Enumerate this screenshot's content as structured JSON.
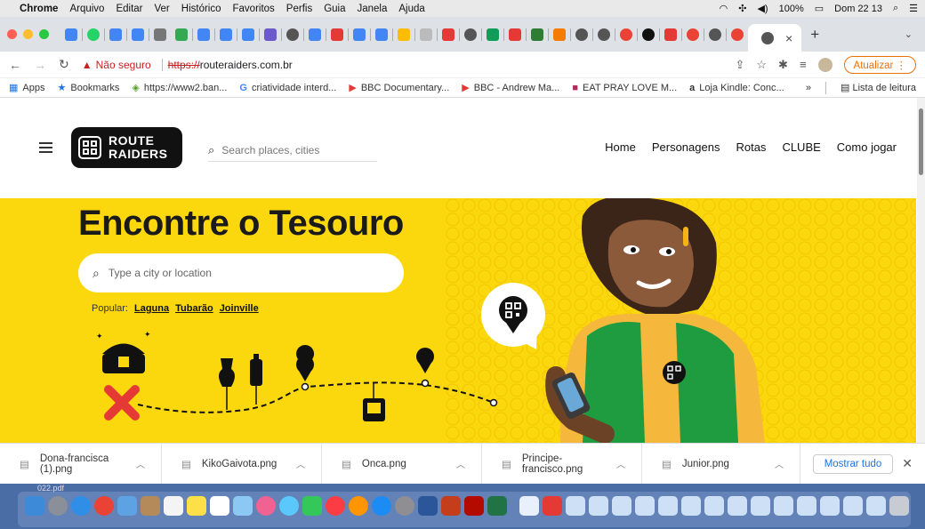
{
  "menubar": {
    "app": "Chrome",
    "items": [
      "Arquivo",
      "Editar",
      "Ver",
      "Histórico",
      "Favoritos",
      "Perfis",
      "Guia",
      "Janela",
      "Ajuda"
    ],
    "battery": "100%",
    "clock": "Dom 22 13"
  },
  "browser": {
    "tab_close": "×",
    "new_tab": "+",
    "insecure_label": "Não seguro",
    "url_protocol": "https://",
    "url_host": "routeraiders.com.br",
    "update_label": "Atualizar"
  },
  "bookmarks": {
    "items": [
      "Apps",
      "Bookmarks",
      "https://www2.ban...",
      "criatividade interd...",
      "BBC Documentary...",
      "BBC - Andrew Ma...",
      "EAT PRAY LOVE M...",
      "Loja Kindle: Conc..."
    ],
    "more": "»",
    "reading_list": "Lista de leitura"
  },
  "site": {
    "logo_line1": "ROUTE",
    "logo_line2": "RAIDERS",
    "header_search_placeholder": "Search places, cities",
    "nav": [
      "Home",
      "Personagens",
      "Rotas",
      "CLUBE",
      "Como jogar"
    ],
    "hero_title": "Encontre o Tesouro",
    "hero_search_placeholder": "Type a city or location",
    "popular_label": "Popular:",
    "popular_links": [
      "Laguna",
      "Tubarão",
      "Joinville"
    ]
  },
  "downloads": {
    "files": [
      "Dona-francisca (1).png",
      "KikoGaivota.png",
      "Onca.png",
      "Principe-francisco.png",
      "Junior.png"
    ],
    "show_all": "Mostrar tudo"
  },
  "dock": {
    "pdf_label": "022.pdf"
  },
  "colors": {
    "hero_yellow": "#fbd80d",
    "insecure_red": "#c5221f",
    "update_orange": "#e8710a"
  }
}
